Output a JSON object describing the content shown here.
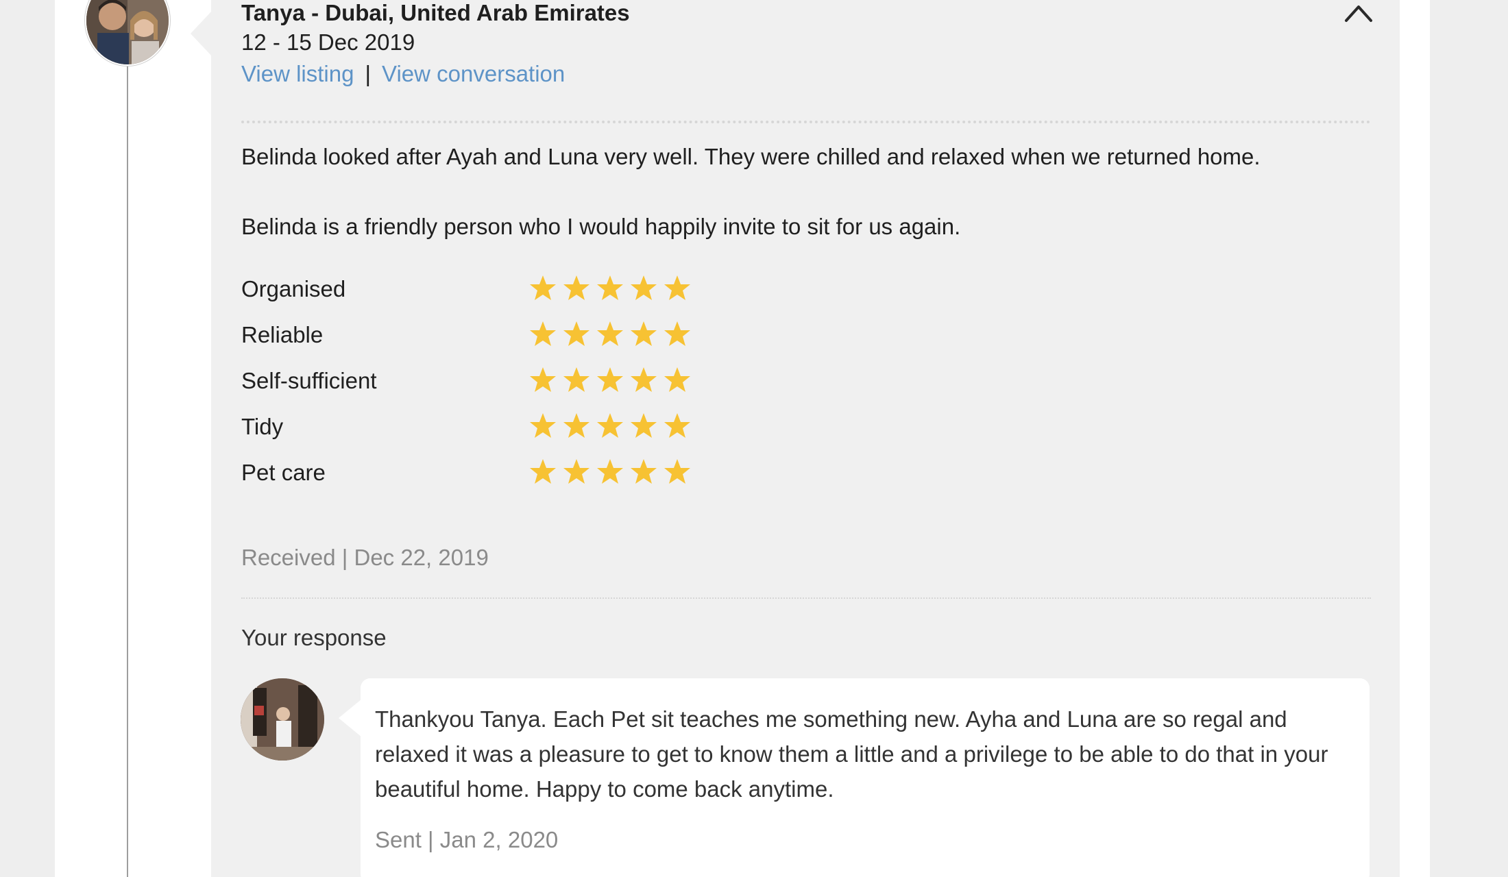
{
  "review": {
    "host_name": "Tanya - Dubai, United Arab Emirates",
    "dates": "12 - 15 Dec 2019",
    "view_listing": "View listing",
    "separator": "|",
    "view_conversation": "View conversation",
    "paragraph_1": "Belinda looked after Ayah and Luna very well. They were chilled and relaxed when we returned home.",
    "paragraph_2": "Belinda is a friendly person who I would happily invite to sit for us again.",
    "ratings": [
      {
        "label": "Organised",
        "stars": 5,
        "max": 5
      },
      {
        "label": "Reliable",
        "stars": 5,
        "max": 5
      },
      {
        "label": "Self-sufficient",
        "stars": 5,
        "max": 5
      },
      {
        "label": "Tidy",
        "stars": 5,
        "max": 5
      },
      {
        "label": "Pet care",
        "stars": 5,
        "max": 5
      }
    ],
    "received": "Received | Dec 22, 2019"
  },
  "response": {
    "heading": "Your response",
    "text": "Thankyou Tanya. Each Pet sit teaches me something new. Ayha and Luna are so regal and relaxed it was a pleasure to get to know them a little and a privilege to be able to do that in your beautiful home. Happy to come back anytime.",
    "sent": "Sent | Jan 2, 2020"
  },
  "colors": {
    "link": "#5d93c7",
    "star": "#f7c233",
    "muted_text": "#8a8a8a",
    "card_bg": "#f0f0f0"
  },
  "icons": {
    "collapse": "chevron-up-icon",
    "rating": "star-icon"
  }
}
